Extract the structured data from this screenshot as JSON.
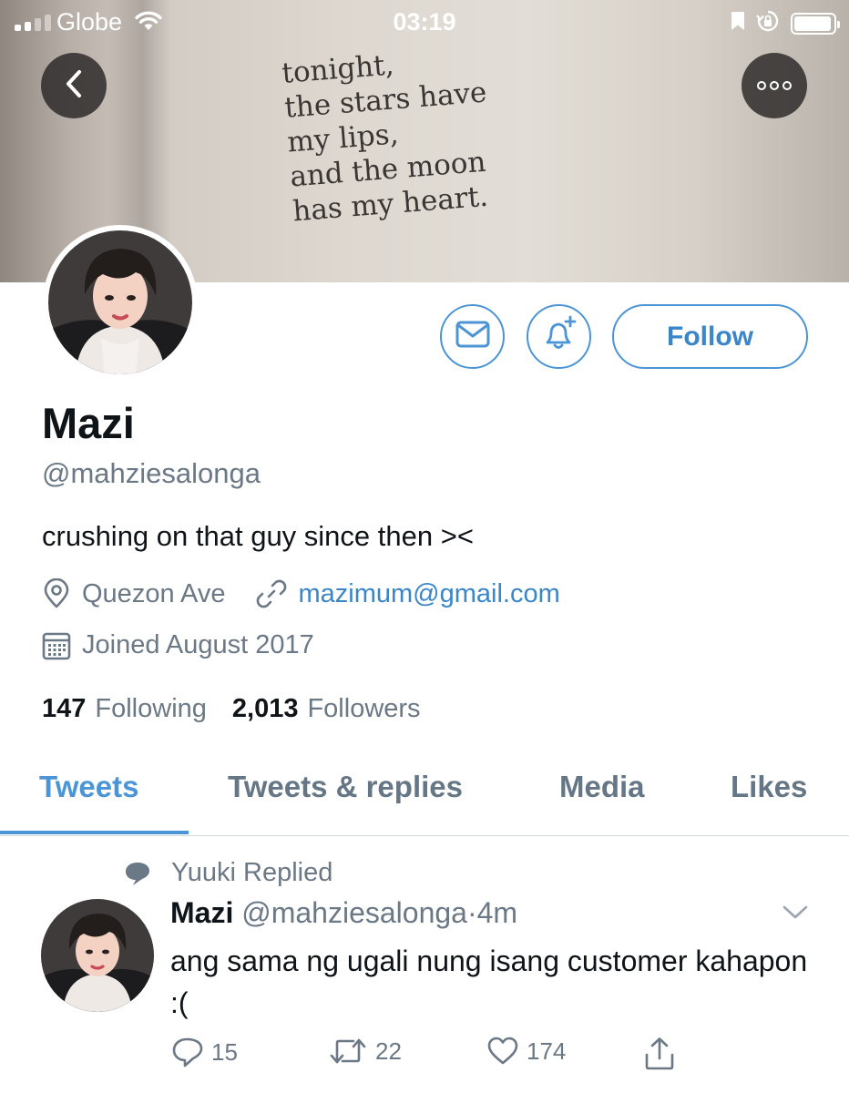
{
  "status_bar": {
    "carrier": "Globe",
    "time": "03:19",
    "signal_bars": 2,
    "battery_level": 0.95
  },
  "banner": {
    "poem_lines": [
      "tonight,",
      "the stars have",
      "my lips,",
      "and the moon",
      "has my heart."
    ]
  },
  "nav": {
    "back_icon": "chevron-left-icon",
    "more_icon": "more-dots-icon"
  },
  "profile": {
    "name": "Mazi",
    "handle": "@mahziesalonga",
    "bio": "crushing on that guy since then ><",
    "location": "Quezon Ave",
    "website": "mazimum@gmail.com",
    "joined": "Joined August 2017",
    "following_count": "147",
    "following_label": "Following",
    "followers_count": "2,013",
    "followers_label": "Followers"
  },
  "actions": {
    "message_icon": "envelope-icon",
    "notify_icon": "bell-plus-icon",
    "follow_label": "Follow"
  },
  "tabs": [
    {
      "label": "Tweets",
      "active": true
    },
    {
      "label": "Tweets & replies",
      "active": false
    },
    {
      "label": "Media",
      "active": false
    },
    {
      "label": "Likes",
      "active": false
    }
  ],
  "tweet": {
    "context": "Yuuki Replied",
    "name": "Mazi",
    "handle": "@mahziesalonga",
    "separator": "·",
    "time": "4m",
    "text": "ang sama ng ugali nung isang customer kahapon :(",
    "replies": "15",
    "retweets": "22",
    "likes": "174"
  },
  "colors": {
    "accent": "#4b95d6",
    "secondary_text": "#6b7885",
    "primary_text": "#0f1419"
  }
}
